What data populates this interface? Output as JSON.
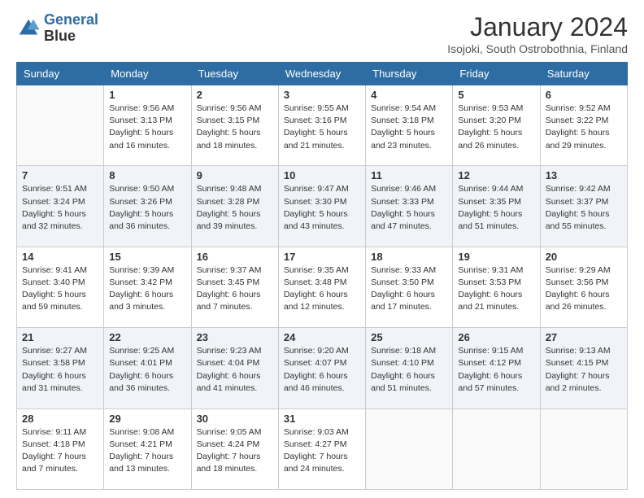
{
  "header": {
    "logo_line1": "General",
    "logo_line2": "Blue",
    "title": "January 2024",
    "subtitle": "Isojoki, South Ostrobothnia, Finland"
  },
  "columns": [
    "Sunday",
    "Monday",
    "Tuesday",
    "Wednesday",
    "Thursday",
    "Friday",
    "Saturday"
  ],
  "weeks": [
    [
      {
        "day": "",
        "sunrise": "",
        "sunset": "",
        "daylight": ""
      },
      {
        "day": "1",
        "sunrise": "Sunrise: 9:56 AM",
        "sunset": "Sunset: 3:13 PM",
        "daylight": "Daylight: 5 hours and 16 minutes."
      },
      {
        "day": "2",
        "sunrise": "Sunrise: 9:56 AM",
        "sunset": "Sunset: 3:15 PM",
        "daylight": "Daylight: 5 hours and 18 minutes."
      },
      {
        "day": "3",
        "sunrise": "Sunrise: 9:55 AM",
        "sunset": "Sunset: 3:16 PM",
        "daylight": "Daylight: 5 hours and 21 minutes."
      },
      {
        "day": "4",
        "sunrise": "Sunrise: 9:54 AM",
        "sunset": "Sunset: 3:18 PM",
        "daylight": "Daylight: 5 hours and 23 minutes."
      },
      {
        "day": "5",
        "sunrise": "Sunrise: 9:53 AM",
        "sunset": "Sunset: 3:20 PM",
        "daylight": "Daylight: 5 hours and 26 minutes."
      },
      {
        "day": "6",
        "sunrise": "Sunrise: 9:52 AM",
        "sunset": "Sunset: 3:22 PM",
        "daylight": "Daylight: 5 hours and 29 minutes."
      }
    ],
    [
      {
        "day": "7",
        "sunrise": "Sunrise: 9:51 AM",
        "sunset": "Sunset: 3:24 PM",
        "daylight": "Daylight: 5 hours and 32 minutes."
      },
      {
        "day": "8",
        "sunrise": "Sunrise: 9:50 AM",
        "sunset": "Sunset: 3:26 PM",
        "daylight": "Daylight: 5 hours and 36 minutes."
      },
      {
        "day": "9",
        "sunrise": "Sunrise: 9:48 AM",
        "sunset": "Sunset: 3:28 PM",
        "daylight": "Daylight: 5 hours and 39 minutes."
      },
      {
        "day": "10",
        "sunrise": "Sunrise: 9:47 AM",
        "sunset": "Sunset: 3:30 PM",
        "daylight": "Daylight: 5 hours and 43 minutes."
      },
      {
        "day": "11",
        "sunrise": "Sunrise: 9:46 AM",
        "sunset": "Sunset: 3:33 PM",
        "daylight": "Daylight: 5 hours and 47 minutes."
      },
      {
        "day": "12",
        "sunrise": "Sunrise: 9:44 AM",
        "sunset": "Sunset: 3:35 PM",
        "daylight": "Daylight: 5 hours and 51 minutes."
      },
      {
        "day": "13",
        "sunrise": "Sunrise: 9:42 AM",
        "sunset": "Sunset: 3:37 PM",
        "daylight": "Daylight: 5 hours and 55 minutes."
      }
    ],
    [
      {
        "day": "14",
        "sunrise": "Sunrise: 9:41 AM",
        "sunset": "Sunset: 3:40 PM",
        "daylight": "Daylight: 5 hours and 59 minutes."
      },
      {
        "day": "15",
        "sunrise": "Sunrise: 9:39 AM",
        "sunset": "Sunset: 3:42 PM",
        "daylight": "Daylight: 6 hours and 3 minutes."
      },
      {
        "day": "16",
        "sunrise": "Sunrise: 9:37 AM",
        "sunset": "Sunset: 3:45 PM",
        "daylight": "Daylight: 6 hours and 7 minutes."
      },
      {
        "day": "17",
        "sunrise": "Sunrise: 9:35 AM",
        "sunset": "Sunset: 3:48 PM",
        "daylight": "Daylight: 6 hours and 12 minutes."
      },
      {
        "day": "18",
        "sunrise": "Sunrise: 9:33 AM",
        "sunset": "Sunset: 3:50 PM",
        "daylight": "Daylight: 6 hours and 17 minutes."
      },
      {
        "day": "19",
        "sunrise": "Sunrise: 9:31 AM",
        "sunset": "Sunset: 3:53 PM",
        "daylight": "Daylight: 6 hours and 21 minutes."
      },
      {
        "day": "20",
        "sunrise": "Sunrise: 9:29 AM",
        "sunset": "Sunset: 3:56 PM",
        "daylight": "Daylight: 6 hours and 26 minutes."
      }
    ],
    [
      {
        "day": "21",
        "sunrise": "Sunrise: 9:27 AM",
        "sunset": "Sunset: 3:58 PM",
        "daylight": "Daylight: 6 hours and 31 minutes."
      },
      {
        "day": "22",
        "sunrise": "Sunrise: 9:25 AM",
        "sunset": "Sunset: 4:01 PM",
        "daylight": "Daylight: 6 hours and 36 minutes."
      },
      {
        "day": "23",
        "sunrise": "Sunrise: 9:23 AM",
        "sunset": "Sunset: 4:04 PM",
        "daylight": "Daylight: 6 hours and 41 minutes."
      },
      {
        "day": "24",
        "sunrise": "Sunrise: 9:20 AM",
        "sunset": "Sunset: 4:07 PM",
        "daylight": "Daylight: 6 hours and 46 minutes."
      },
      {
        "day": "25",
        "sunrise": "Sunrise: 9:18 AM",
        "sunset": "Sunset: 4:10 PM",
        "daylight": "Daylight: 6 hours and 51 minutes."
      },
      {
        "day": "26",
        "sunrise": "Sunrise: 9:15 AM",
        "sunset": "Sunset: 4:12 PM",
        "daylight": "Daylight: 6 hours and 57 minutes."
      },
      {
        "day": "27",
        "sunrise": "Sunrise: 9:13 AM",
        "sunset": "Sunset: 4:15 PM",
        "daylight": "Daylight: 7 hours and 2 minutes."
      }
    ],
    [
      {
        "day": "28",
        "sunrise": "Sunrise: 9:11 AM",
        "sunset": "Sunset: 4:18 PM",
        "daylight": "Daylight: 7 hours and 7 minutes."
      },
      {
        "day": "29",
        "sunrise": "Sunrise: 9:08 AM",
        "sunset": "Sunset: 4:21 PM",
        "daylight": "Daylight: 7 hours and 13 minutes."
      },
      {
        "day": "30",
        "sunrise": "Sunrise: 9:05 AM",
        "sunset": "Sunset: 4:24 PM",
        "daylight": "Daylight: 7 hours and 18 minutes."
      },
      {
        "day": "31",
        "sunrise": "Sunrise: 9:03 AM",
        "sunset": "Sunset: 4:27 PM",
        "daylight": "Daylight: 7 hours and 24 minutes."
      },
      {
        "day": "",
        "sunrise": "",
        "sunset": "",
        "daylight": ""
      },
      {
        "day": "",
        "sunrise": "",
        "sunset": "",
        "daylight": ""
      },
      {
        "day": "",
        "sunrise": "",
        "sunset": "",
        "daylight": ""
      }
    ]
  ]
}
